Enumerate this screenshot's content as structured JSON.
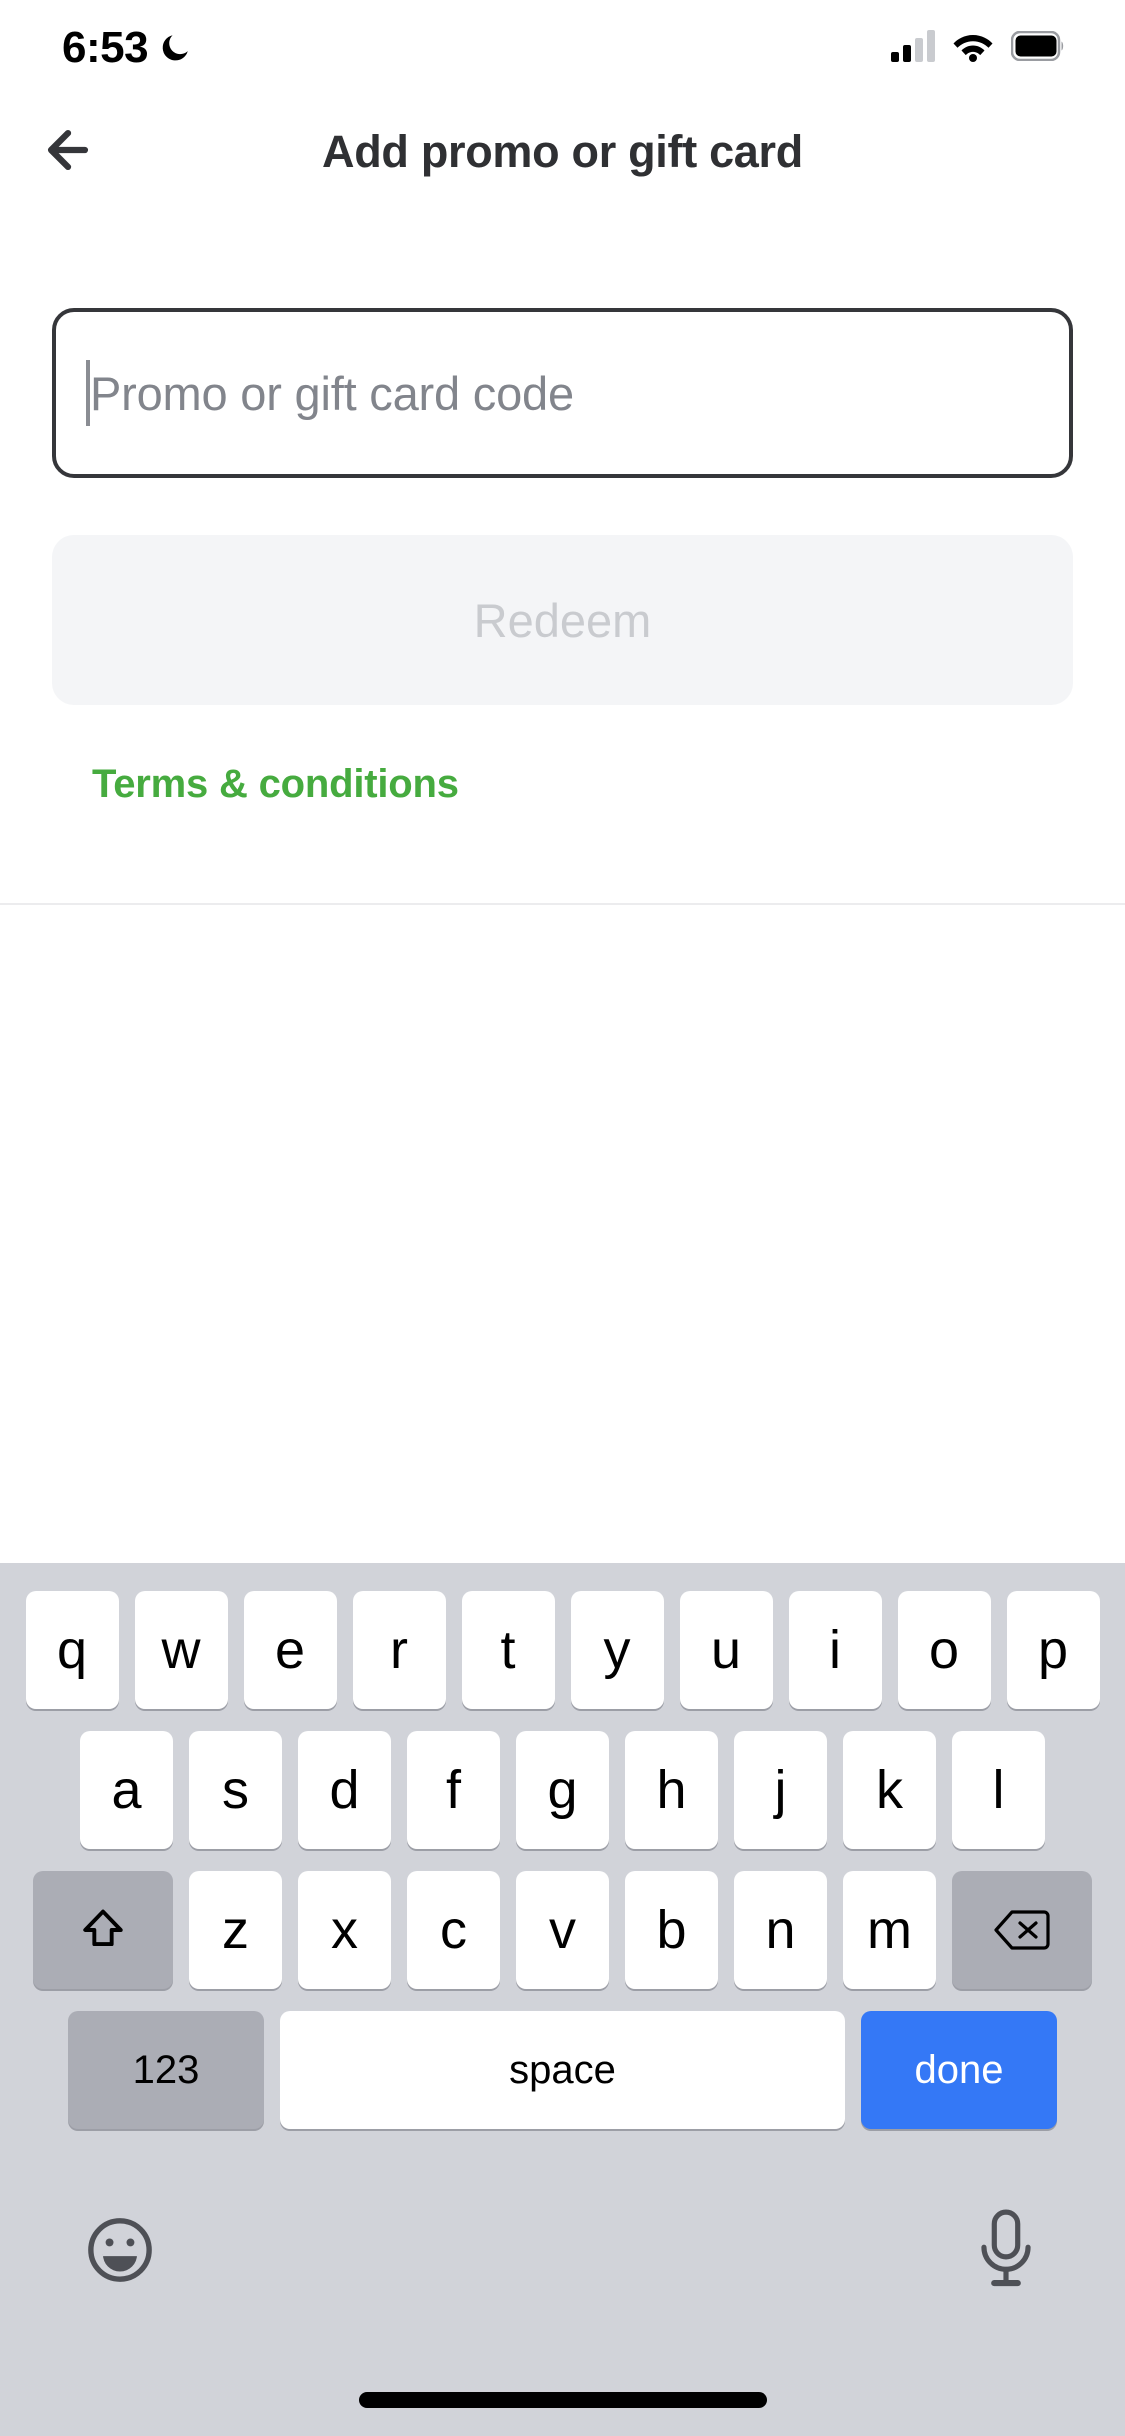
{
  "status_bar": {
    "time": "6:53",
    "dnd_icon": "moon-icon",
    "signal_icon": "cellular-signal-icon",
    "signal_bars_filled": 2,
    "signal_bars_total": 4,
    "wifi_icon": "wifi-icon",
    "battery_icon": "battery-icon",
    "battery_level": 95
  },
  "header": {
    "back_icon": "arrow-left-icon",
    "title": "Add promo or gift card"
  },
  "form": {
    "code_input": {
      "value": "",
      "placeholder": "Promo or gift card code",
      "focused": true
    },
    "redeem_button": {
      "label": "Redeem",
      "enabled": false
    },
    "terms_link": "Terms & conditions"
  },
  "colors": {
    "accent_green": "#46ab3f",
    "done_blue": "#3478f6",
    "keyboard_bg": "#d1d3d9",
    "mod_key": "#abadb5",
    "disabled_bg": "#f4f5f7",
    "disabled_text": "#c9cbcf",
    "title_text": "#2f3033",
    "placeholder_text": "#82858c",
    "input_border": "#35363a"
  },
  "keyboard": {
    "layout": "qwerty-lowercase",
    "row1": [
      "q",
      "w",
      "e",
      "r",
      "t",
      "y",
      "u",
      "i",
      "o",
      "p"
    ],
    "row2": [
      "a",
      "s",
      "d",
      "f",
      "g",
      "h",
      "j",
      "k",
      "l"
    ],
    "row3_letters": [
      "z",
      "x",
      "c",
      "v",
      "b",
      "n",
      "m"
    ],
    "shift_icon": "shift-arrow-up-icon",
    "backspace_icon": "backspace-delete-icon",
    "numbers_key": "123",
    "space_key": "space",
    "done_key": "done",
    "emoji_icon": "emoji-smiley-icon",
    "mic_icon": "microphone-icon",
    "home_indicator": "home-indicator-bar"
  }
}
